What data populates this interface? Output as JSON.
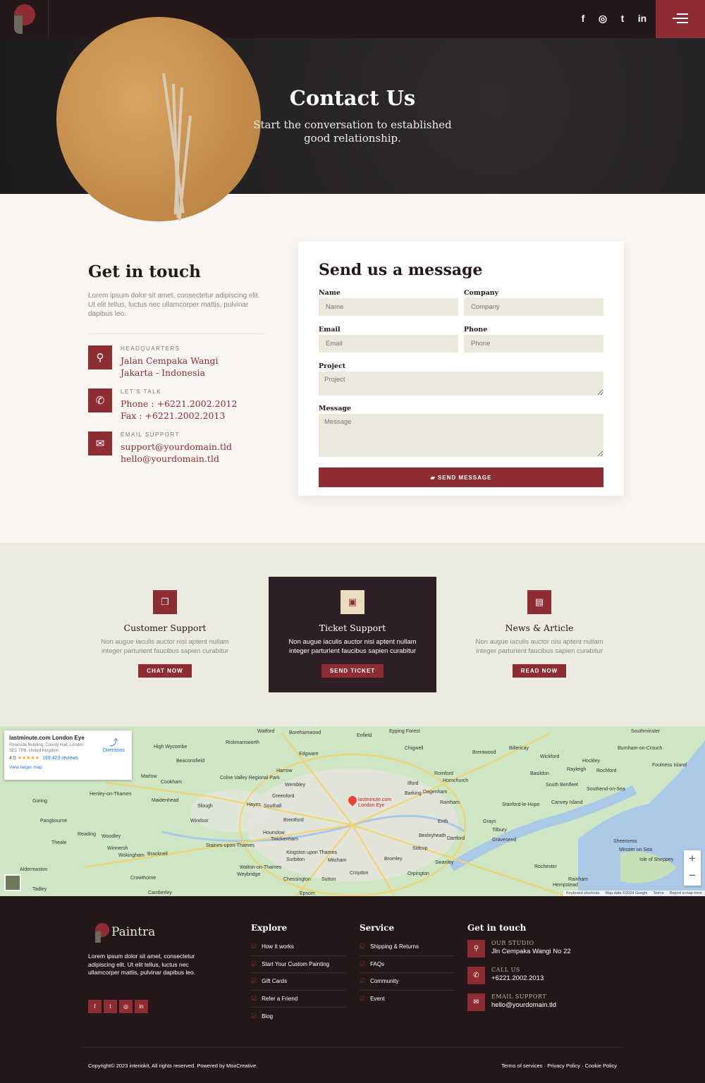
{
  "colors": {
    "accent": "#8f2d35",
    "dark": "#231719",
    "card_dark": "#2f2027",
    "input_bg": "#ebe9dc"
  },
  "header": {
    "social": [
      {
        "icon": "facebook-icon",
        "glyph": "f"
      },
      {
        "icon": "instagram-icon",
        "glyph": "◎"
      },
      {
        "icon": "twitter-icon",
        "glyph": "🐦"
      },
      {
        "icon": "linkedin-icon",
        "glyph": "in"
      }
    ],
    "menu_icon": "hamburger-icon"
  },
  "hero": {
    "title": "Contact Us",
    "subtitle": "Start the conversation to established good relationship."
  },
  "get_in_touch": {
    "title": "Get in touch",
    "description": "Lorem ipsum dolor sit amet, consectetur adipiscing elit. Ut elit tellus, luctus nec ullamcorper mattis, pulvinar dapibus leo.",
    "items": [
      {
        "icon": "map-pin-icon",
        "label": "HEADQUARTERS",
        "lines": [
          "Jalan Cempaka Wangi",
          "Jakarta - Indonesia"
        ]
      },
      {
        "icon": "phone-icon",
        "label": "LET'S TALK",
        "lines": [
          "Phone : +6221.2002.2012",
          "Fax : +6221.2002.2013"
        ]
      },
      {
        "icon": "envelope-icon",
        "label": "EMAIL SUPPORT",
        "lines": [
          "support@yourdomain.tld",
          "hello@yourdomain.tld"
        ]
      }
    ]
  },
  "form": {
    "title": "Send us a message",
    "fields": {
      "name": {
        "label": "Name",
        "placeholder": "Name"
      },
      "company": {
        "label": "Company",
        "placeholder": "Company"
      },
      "email": {
        "label": "Email",
        "placeholder": "Email"
      },
      "phone": {
        "label": "Phone",
        "placeholder": "Phone"
      },
      "project": {
        "label": "Project",
        "placeholder": "Project"
      },
      "message": {
        "label": "Message",
        "placeholder": "Message"
      }
    },
    "submit": "SEND MESSAGE"
  },
  "support": [
    {
      "icon": "chat-icon",
      "title": "Customer Support",
      "text": "Non augue iaculis auctor nisi aptent nullam integer parturient faucibus sapien curabitur",
      "button": "CHAT NOW"
    },
    {
      "icon": "ticket-icon",
      "title": "Ticket Support",
      "text": "Non augue iaculis auctor nisi aptent nullam integer parturient faucibus sapien curabitur",
      "button": "SEND TICKET"
    },
    {
      "icon": "newspaper-icon",
      "title": "News & Article",
      "text": "Non augue iaculis auctor nisi aptent nullam integer parturient faucibus sapien curabitur",
      "button": "READ NOW"
    }
  ],
  "map": {
    "place": "lastminute.com London Eye",
    "address": "Riverside Building, County Hall, London SE1 7PB, United Kingdom",
    "rating": "4.5",
    "stars": "★★★★★",
    "reviews": "169.423 reviews",
    "larger": "View larger map",
    "directions": "Directions",
    "marker_label": "lastminute.com London Eye",
    "places": [
      "Watford",
      "Borehamwood",
      "Enfield",
      "Epping Forest",
      "High Wycombe",
      "Rickmansworth",
      "Chigwell",
      "Brentwood",
      "Billericay",
      "Wickford",
      "Southminster",
      "Burnham-on-Crouch",
      "Beaconsfield",
      "Edgware",
      "Harrow",
      "Romford",
      "Hornchurch",
      "Basildon",
      "Hockley",
      "Rayleigh",
      "Rochford",
      "Foulness Island",
      "Marlow",
      "Cookham",
      "Colne Valley Regional Park",
      "Wembley",
      "Ilford",
      "Dagenham",
      "South Benfleet",
      "Southend-on-Sea",
      "Henley-on-Thames",
      "Maidenhead",
      "Slough",
      "Hayes",
      "Southall",
      "Greenford",
      "Barking",
      "Rainham",
      "Stanford-le-Hope",
      "Canvey Island",
      "Goring",
      "Windsor",
      "Brentford",
      "Erith",
      "Grays",
      "Tilbury",
      "Pangbourne",
      "Hounslow",
      "Twickenham",
      "Bexleyheath",
      "Dartford",
      "Gravesend",
      "Reading",
      "Woodley",
      "Theale",
      "Winnersh",
      "Wokingham",
      "Bracknell",
      "Staines-upon-Thames",
      "Kingston upon Thames",
      "Surbiton",
      "Mitcham",
      "Bromley",
      "Sidcup",
      "Swanley",
      "Sheerness",
      "Minster on Sea",
      "Isle of Sheppey",
      "Rochester",
      "Aldermaston",
      "Walton-on-Thames",
      "Weybridge",
      "Croydon",
      "Orpington",
      "Crowthorne",
      "Chessington",
      "Sutton",
      "Rainham",
      "Hempstead",
      "Tadley",
      "Camberley",
      "Epsom",
      "Google"
    ],
    "attribution": [
      "Keyboard shortcuts",
      "Map data ©2024 Google",
      "Terms",
      "Report a map error"
    ],
    "zoom_in": "+",
    "zoom_out": "−"
  },
  "footer": {
    "brand": "Paintra",
    "description": "Lorem ipsum dolor sit amet, consectetur adipiscing elit. Ut elit tellus, luctus nec ullamcorper mattis, pulvinar dapibus leo.",
    "social": [
      {
        "icon": "facebook-icon",
        "glyph": "f"
      },
      {
        "icon": "twitter-icon",
        "glyph": "t"
      },
      {
        "icon": "instagram-icon",
        "glyph": "◎"
      },
      {
        "icon": "linkedin-icon",
        "glyph": "in"
      }
    ],
    "explore": {
      "title": "Explore",
      "items": [
        "How It works",
        "Start Your Custom Painting",
        "Gift Cards",
        "Refer a Friend",
        "Blog"
      ]
    },
    "service": {
      "title": "Service",
      "items": [
        "Shipping & Returns",
        "FAQs",
        "Community",
        "Event"
      ]
    },
    "contact": {
      "title": "Get in touch",
      "items": [
        {
          "icon": "map-pin-icon",
          "label": "OUR STUDIO",
          "value": "Jln Cempaka Wangi No 22"
        },
        {
          "icon": "phone-icon",
          "label": "CALL US",
          "value": "+6221.2002.2013"
        },
        {
          "icon": "envelope-icon",
          "label": "EMAIL SUPPORT",
          "value": "hello@yourdomain.tld"
        }
      ]
    },
    "copyright": "Copyright© 2023 interiokit, All rights reserved. Powered by MoxCreative.",
    "links": [
      "Terms of services",
      "Privacy Policy",
      "Cookie Policy"
    ]
  }
}
